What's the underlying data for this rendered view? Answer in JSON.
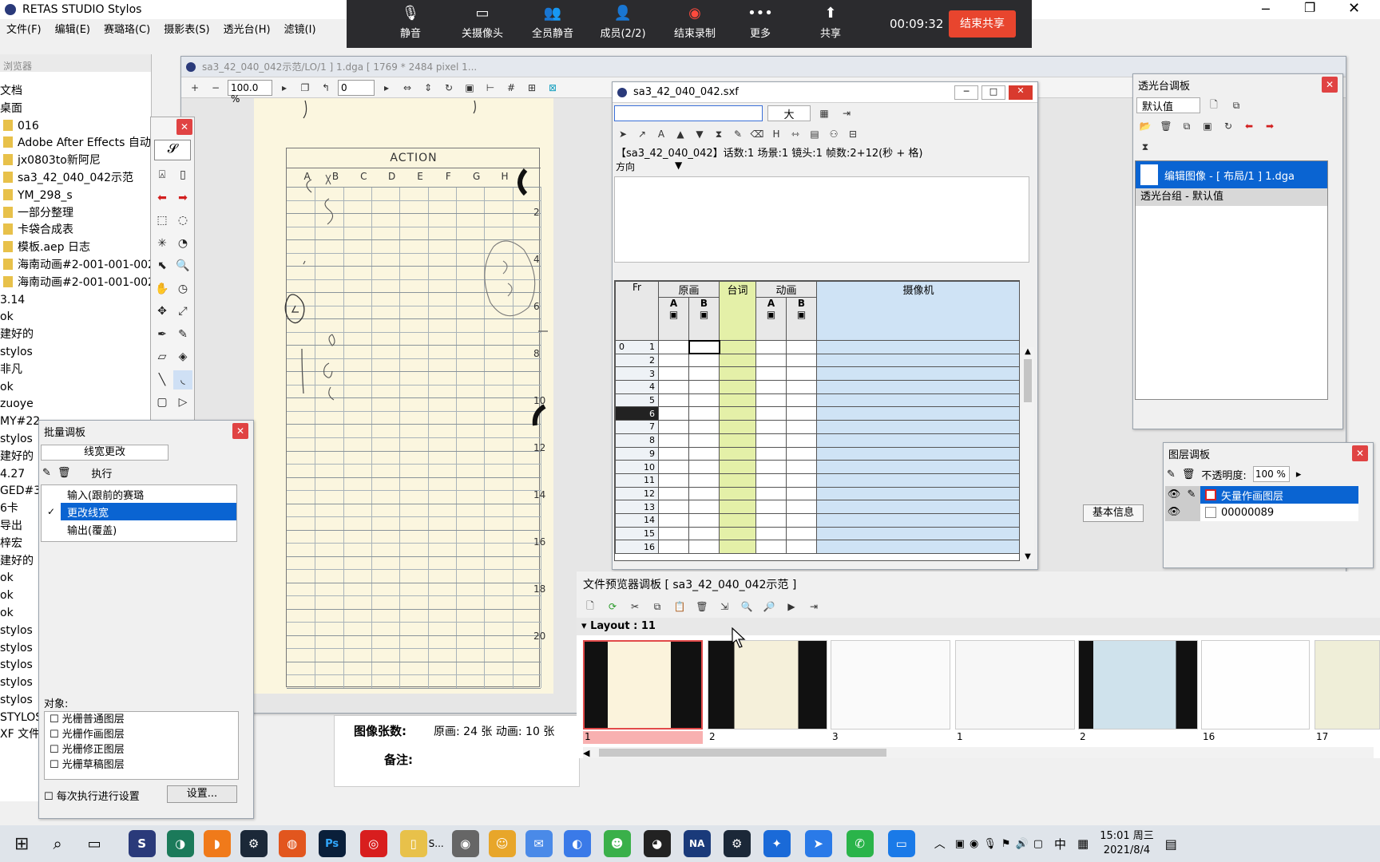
{
  "app": {
    "title": "RETAS STUDIO Stylos",
    "menu": [
      "文件(F)",
      "编辑(E)",
      "赛璐珞(C)",
      "摄影表(S)",
      "透光台(H)",
      "滤镜(I)"
    ]
  },
  "meeting": {
    "buttons": [
      {
        "label": "静音",
        "icon": "microphone-icon"
      },
      {
        "label": "关摄像头",
        "icon": "camera-icon"
      },
      {
        "label": "全员静音",
        "icon": "mute-all-icon"
      },
      {
        "label": "成员(2/2)",
        "icon": "members-icon"
      },
      {
        "label": "结束录制",
        "icon": "record-icon"
      },
      {
        "label": "更多",
        "icon": "more-icon"
      },
      {
        "label": "共享",
        "icon": "share-icon"
      }
    ],
    "timer": "00:09:32",
    "end_share": "结束共享"
  },
  "browser_panel": {
    "title": "浏览器",
    "items": [
      "文档",
      "桌面",
      "016",
      "Adobe After Effects 自动",
      "jx0803to新阿尼",
      "sa3_42_040_042示范",
      "YM_298_s",
      "一部分整理",
      "卡袋合成表",
      "模板.aep 日志",
      "海南动画#2-001-001-002",
      "海南动画#2-001-001-002",
      "3.14",
      "ok",
      "建好的",
      "stylos",
      "非凡",
      "ok",
      "zuoye",
      "MY#22",
      "stylos",
      "建好的",
      "4.27",
      "GED#3",
      "6卡",
      "导出",
      "梓宏",
      "建好的",
      "ok",
      "ok",
      "ok",
      "stylos",
      "stylos",
      "stylos",
      "stylos",
      "stylos",
      "STYLOS",
      "XF 文件"
    ]
  },
  "canvas_window": {
    "title": "sa3_42_040_042示范/LO/1 ] 1.dga [ 1769 * 2484 pixel 1...",
    "zoom": "100.0 %",
    "rotation": "0",
    "sheet_title": "ACTION",
    "columns": [
      "A",
      "B",
      "C",
      "D",
      "E",
      "F",
      "G",
      "H"
    ],
    "row_numbers": [
      "2",
      "4",
      "6",
      "8",
      "10",
      "12",
      "14",
      "16",
      "18",
      "20"
    ]
  },
  "batch_panel": {
    "title": "批量调板",
    "dropdown": "线宽更改",
    "execute": "执行",
    "items": [
      {
        "label": "输入(跟前的赛璐",
        "checked": false
      },
      {
        "label": "更改线宽",
        "checked": true
      },
      {
        "label": "输出(覆盖)",
        "checked": false
      }
    ],
    "target_label": "对象:",
    "targets": [
      "光栅普通图层",
      "光栅作画图层",
      "光栅修正图层",
      "光栅草稿图层"
    ],
    "every_time": "每次执行进行设置",
    "settings": "设置..."
  },
  "palette": {
    "colors": [
      "#000000",
      "#101828",
      "#e11b22",
      "#1a2bd6",
      "#22dd22",
      "#18c8f0",
      "#ee22ee",
      "#7a0a0a",
      "#c8c8c8"
    ]
  },
  "xsheet": {
    "title": "sa3_42_040_042.sxf",
    "size_option": "大",
    "info": "【sa3_42_040_042】话数:1 场景:1 镜头:1 帧数:2+12(秒 + 格)",
    "direction": "方向",
    "headers": {
      "fr": "Fr",
      "genga": "原画",
      "dialog": "台词",
      "douga": "动画",
      "camera": "摄像机"
    },
    "subheaders": [
      "A",
      "B",
      "A",
      "B"
    ],
    "frames": [
      "1",
      "2",
      "3",
      "4",
      "5",
      "6",
      "7",
      "8",
      "9",
      "10",
      "11",
      "12",
      "13",
      "14",
      "15",
      "16"
    ],
    "first_frame_sec": "0",
    "current_frame": "6"
  },
  "lightbox_panel": {
    "title": "透光台调板",
    "preset": "默认值",
    "item1": "编辑图像 - [ 布局/1 ] 1.dga",
    "item2": "透光台组 - 默认值"
  },
  "layer_panel": {
    "title": "图层调板",
    "opacity_label": "不透明度:",
    "opacity": "100 %",
    "layers": [
      "矢量作画图层",
      "00000089"
    ]
  },
  "tabs": {
    "basic": "基本信息"
  },
  "preview_panel": {
    "title": "文件预览器调板 [ sa3_42_040_042示范 ]",
    "group": "Layout : 11",
    "thumbs": [
      "1",
      "2",
      "3",
      "1",
      "2",
      "16",
      "17"
    ]
  },
  "info_panel": {
    "images_label": "图像张数:",
    "images_value": "原画: 24 张 动画: 10 张",
    "notes_label": "备注:"
  },
  "taskbar": {
    "time": "15:01 周三",
    "date": "2021/8/4",
    "lang": "中"
  }
}
